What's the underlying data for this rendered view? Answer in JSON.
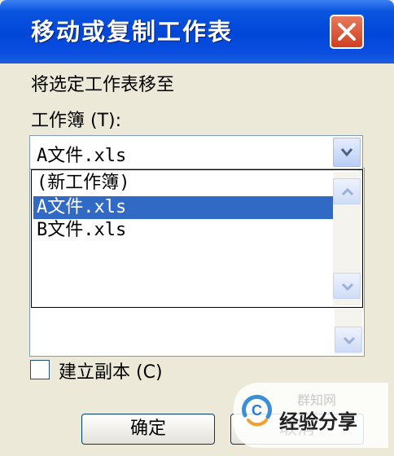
{
  "window": {
    "title": "移动或复制工作表"
  },
  "move_label": "将选定工作表移至",
  "workbook_label": "工作簿 (T):",
  "workbook_combo": {
    "selected": "A文件.xls",
    "options": [
      "(新工作簿)",
      "A文件.xls",
      "B文件.xls"
    ],
    "highlighted_index": 1
  },
  "copy_checkbox": {
    "label": "建立副本 (C)",
    "checked": false
  },
  "buttons": {
    "ok": "确定",
    "cancel": "取消"
  },
  "watermark": {
    "text": "经验分享",
    "sub": "群知网"
  },
  "colors": {
    "title_bar": "#0046d8",
    "selection": "#316ac5",
    "dialog_bg": "#ece9d8"
  }
}
